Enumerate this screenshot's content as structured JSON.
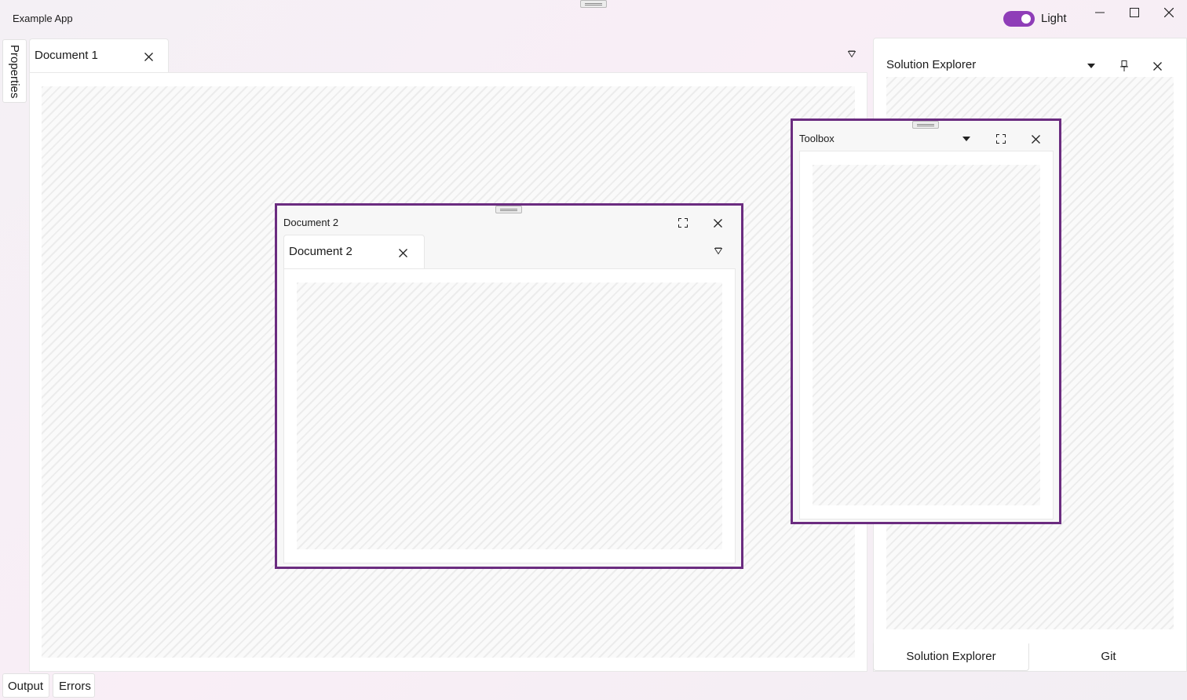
{
  "app": {
    "title": "Example App"
  },
  "theme_toggle": {
    "label": "Light",
    "on": true,
    "accent": "#8f3db8"
  },
  "left_sidebar": {
    "properties_tab": "Properties"
  },
  "document_area": {
    "tabs": [
      {
        "label": "Document 1"
      }
    ]
  },
  "solution_explorer": {
    "title": "Solution Explorer",
    "bottom_tabs": [
      {
        "label": "Solution Explorer"
      },
      {
        "label": "Git"
      }
    ]
  },
  "floating_document": {
    "title": "Document 2",
    "tabs": [
      {
        "label": "Document 2"
      }
    ]
  },
  "floating_toolbox": {
    "title": "Toolbox"
  },
  "bottom_bar": {
    "tabs": [
      {
        "label": "Output"
      },
      {
        "label": "Errors"
      }
    ]
  },
  "colors": {
    "float_border": "#6b2c80",
    "accent": "#8f3db8"
  },
  "icons": [
    "minimize-icon",
    "maximize-icon",
    "close-icon",
    "dropdown-triangle-icon",
    "pin-icon",
    "expand-icon",
    "drag-grip-icon"
  ]
}
